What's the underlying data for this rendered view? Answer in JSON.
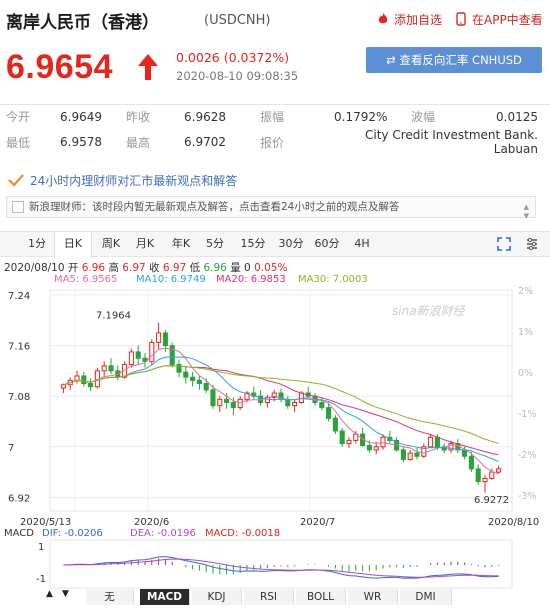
{
  "header": {
    "title": "离岸人民币（香港）",
    "code": "(USDCNH)",
    "add_watch_label": "添加自选",
    "app_label": "在APP中查看"
  },
  "quote": {
    "price": "6.9654",
    "change": "0.0026 (0.0372%)",
    "time": "2020-08-10 09:08:35",
    "reverse_button": "⇄ 查看反向汇率 CNHUSD"
  },
  "stats": [
    [
      {
        "label": "今开",
        "value": "6.9649"
      },
      {
        "label": "昨收",
        "value": "6.9628"
      },
      {
        "label": "振幅",
        "value": "0.1792%"
      },
      {
        "label": "波幅",
        "value": "0.0125"
      }
    ],
    [
      {
        "label": "最低",
        "value": "6.9578"
      },
      {
        "label": "最高",
        "value": "6.9702"
      },
      {
        "label": "报价",
        "value": "City Credit Investment Bank. Labuan"
      }
    ]
  ],
  "advisor": {
    "link": "24小时内理财师对汇市最新观点和解答",
    "note": "新浪理财师：该时段内暂无最新观点及解答，点击查看24小时之前的观点及解答"
  },
  "tabs": [
    "1分",
    "日K",
    "周K",
    "月K",
    "年K",
    "5分",
    "15分",
    "30分",
    "60分",
    "4H"
  ],
  "active_tab": "日K",
  "ohlc": {
    "date": "2020/08/10",
    "open_label": "开",
    "open": "6.96",
    "high_label": "高",
    "high": "6.97",
    "close_label": "收",
    "close": "6.97",
    "low_label": "低",
    "low": "6.96",
    "vol_label": "量",
    "vol": "0",
    "pct": "0.05%"
  },
  "ma": [
    {
      "label": "MA5: 6.9565",
      "color": "#e66ea0"
    },
    {
      "label": "MA10: 6.9749",
      "color": "#2aa5d8"
    },
    {
      "label": "MA20: 6.9853",
      "color": "#e8306a"
    },
    {
      "label": "MA30: 7.0003",
      "color": "#8cb624"
    }
  ],
  "colors": {
    "up": "#e4261c",
    "down": "#29a33a",
    "accent": "#5d8fd4"
  },
  "chart_data": {
    "type": "candlestick",
    "y_ticks": [
      "7.24",
      "7.16",
      "7.08",
      "7",
      "6.92"
    ],
    "pct_ticks": [
      "2%",
      "1%",
      "0%",
      "-1%",
      "-2%",
      "-3%"
    ],
    "x_labels": [
      "2020/5/13",
      "2020/6",
      "2020/7",
      "2020/8/10"
    ],
    "ylim": [
      6.92,
      7.24
    ],
    "max_label": "7.1964",
    "min_label": "6.9272",
    "watermark": "sina新浪财经",
    "macd": {
      "label": "MACD",
      "dif": "DIF: -0.0206",
      "dea": "DEA: -0.0196",
      "macd": "MACD: -0.0018",
      "ticks": [
        "1",
        "-1"
      ]
    },
    "candles": [
      [
        7.093,
        7.1,
        7.085,
        7.098
      ],
      [
        7.098,
        7.11,
        7.09,
        7.105
      ],
      [
        7.105,
        7.12,
        7.1,
        7.112
      ],
      [
        7.112,
        7.118,
        7.095,
        7.1
      ],
      [
        7.1,
        7.108,
        7.088,
        7.095
      ],
      [
        7.095,
        7.125,
        7.092,
        7.12
      ],
      [
        7.12,
        7.135,
        7.11,
        7.128
      ],
      [
        7.128,
        7.14,
        7.115,
        7.12
      ],
      [
        7.12,
        7.128,
        7.105,
        7.11
      ],
      [
        7.11,
        7.135,
        7.108,
        7.13
      ],
      [
        7.13,
        7.155,
        7.125,
        7.15
      ],
      [
        7.15,
        7.16,
        7.13,
        7.14
      ],
      [
        7.14,
        7.148,
        7.125,
        7.135
      ],
      [
        7.135,
        7.17,
        7.13,
        7.165
      ],
      [
        7.165,
        7.196,
        7.155,
        7.18
      ],
      [
        7.18,
        7.185,
        7.15,
        7.16
      ],
      [
        7.16,
        7.165,
        7.125,
        7.13
      ],
      [
        7.13,
        7.138,
        7.11,
        7.118
      ],
      [
        7.118,
        7.128,
        7.1,
        7.11
      ],
      [
        7.11,
        7.118,
        7.095,
        7.105
      ],
      [
        7.105,
        7.112,
        7.09,
        7.1
      ],
      [
        7.1,
        7.108,
        7.085,
        7.09
      ],
      [
        7.09,
        7.098,
        7.06,
        7.065
      ],
      [
        7.065,
        7.08,
        7.055,
        7.075
      ],
      [
        7.075,
        7.085,
        7.06,
        7.07
      ],
      [
        7.07,
        7.078,
        7.05,
        7.062
      ],
      [
        7.062,
        7.08,
        7.058,
        7.075
      ],
      [
        7.075,
        7.088,
        7.07,
        7.085
      ],
      [
        7.085,
        7.095,
        7.075,
        7.08
      ],
      [
        7.08,
        7.09,
        7.065,
        7.07
      ],
      [
        7.07,
        7.082,
        7.062,
        7.078
      ],
      [
        7.078,
        7.09,
        7.072,
        7.085
      ],
      [
        7.085,
        7.092,
        7.07,
        7.075
      ],
      [
        7.075,
        7.08,
        7.06,
        7.065
      ],
      [
        7.065,
        7.075,
        7.055,
        7.07
      ],
      [
        7.07,
        7.088,
        7.068,
        7.085
      ],
      [
        7.085,
        7.095,
        7.078,
        7.08
      ],
      [
        7.08,
        7.085,
        7.065,
        7.07
      ],
      [
        7.07,
        7.078,
        7.058,
        7.062
      ],
      [
        7.062,
        7.07,
        7.04,
        7.045
      ],
      [
        7.045,
        7.05,
        7.02,
        7.025
      ],
      [
        7.025,
        7.03,
        7.0,
        7.005
      ],
      [
        7.005,
        7.015,
        6.998,
        7.01
      ],
      [
        7.01,
        7.025,
        7.005,
        7.02
      ],
      [
        7.02,
        7.03,
        7.0,
        7.002
      ],
      [
        7.002,
        7.01,
        6.99,
        6.995
      ],
      [
        6.995,
        7.008,
        6.988,
        7.0
      ],
      [
        7.0,
        7.02,
        6.995,
        7.015
      ],
      [
        7.015,
        7.025,
        7.005,
        7.01
      ],
      [
        7.01,
        7.015,
        6.992,
        6.995
      ],
      [
        6.995,
        7.0,
        6.975,
        6.98
      ],
      [
        6.98,
        6.995,
        6.978,
        6.99
      ],
      [
        6.99,
        6.998,
        6.98,
        6.985
      ],
      [
        6.985,
        7.005,
        6.982,
        7.0
      ],
      [
        7.0,
        7.02,
        6.998,
        7.015
      ],
      [
        7.015,
        7.02,
        6.995,
        7.0
      ],
      [
        7.0,
        7.005,
        6.99,
        6.995
      ],
      [
        6.995,
        7.01,
        6.99,
        7.005
      ],
      [
        7.005,
        7.012,
        6.99,
        6.995
      ],
      [
        6.995,
        7.0,
        6.98,
        6.985
      ],
      [
        6.985,
        6.992,
        6.96,
        6.965
      ],
      [
        6.965,
        6.972,
        6.94,
        6.945
      ],
      [
        6.945,
        6.955,
        6.927,
        6.95
      ],
      [
        6.95,
        6.965,
        6.948,
        6.96
      ],
      [
        6.96,
        6.97,
        6.958,
        6.965
      ]
    ]
  }
}
